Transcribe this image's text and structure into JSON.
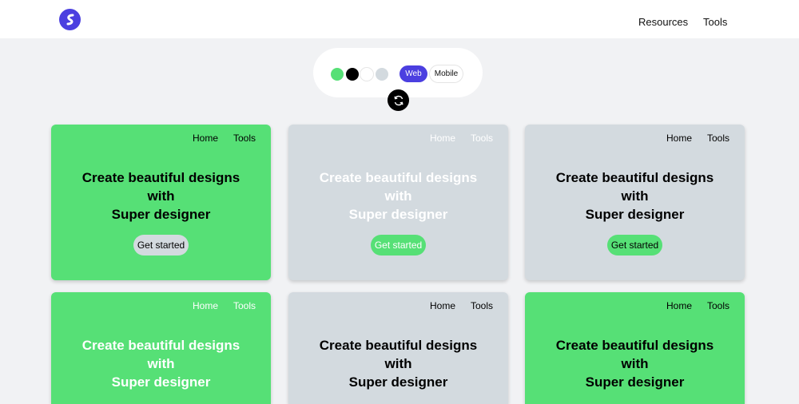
{
  "header": {
    "nav": [
      "Resources",
      "Tools"
    ]
  },
  "picker": {
    "swatches": [
      {
        "name": "green",
        "color": "#56e076"
      },
      {
        "name": "black",
        "color": "#000000"
      },
      {
        "name": "white",
        "color": "#ffffff"
      },
      {
        "name": "gray",
        "color": "#d3dadf"
      }
    ],
    "tabs": [
      "Web",
      "Mobile"
    ],
    "selected_tab": "Web"
  },
  "colors": {
    "accent": "#4b3fe0",
    "green": "#56e076",
    "gray": "#d3dadf",
    "background": "#f1f2f4"
  },
  "cards": [
    {
      "nav_home": "Home",
      "nav_tools": "Tools",
      "line1": "Create beautiful designs",
      "line2": "with",
      "line3": "Super designer",
      "cta": "Get started"
    },
    {
      "nav_home": "Home",
      "nav_tools": "Tools",
      "line1": "Create beautiful designs",
      "line2": "with",
      "line3": "Super designer",
      "cta": "Get started"
    },
    {
      "nav_home": "Home",
      "nav_tools": "Tools",
      "line1": "Create beautiful designs",
      "line2": "with",
      "line3": "Super designer",
      "cta": "Get started"
    },
    {
      "nav_home": "Home",
      "nav_tools": "Tools",
      "line1": "Create beautiful designs",
      "line2": "with",
      "line3": "Super designer"
    },
    {
      "nav_home": "Home",
      "nav_tools": "Tools",
      "line1": "Create beautiful designs",
      "line2": "with",
      "line3": "Super designer"
    },
    {
      "nav_home": "Home",
      "nav_tools": "Tools",
      "line1": "Create beautiful designs",
      "line2": "with",
      "line3": "Super designer"
    }
  ]
}
